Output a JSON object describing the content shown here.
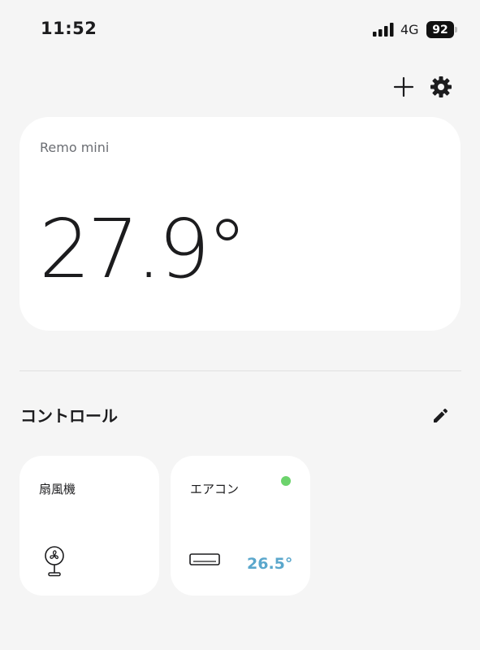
{
  "status_bar": {
    "time": "11:52",
    "network": "4G",
    "battery": "92"
  },
  "sensor_card": {
    "device_name": "Remo mini",
    "temperature": "27.9°"
  },
  "controls": {
    "section_title": "コントロール",
    "items": [
      {
        "label": "扇風機",
        "icon": "fan-icon"
      },
      {
        "label": "エアコン",
        "icon": "air-conditioner-icon",
        "temperature": "26.5°",
        "status_color": "#6cd36c"
      }
    ]
  },
  "colors": {
    "background": "#f5f5f5",
    "card": "#ffffff",
    "accent_temp": "#5aa7cc",
    "status_on": "#6cd36c"
  }
}
